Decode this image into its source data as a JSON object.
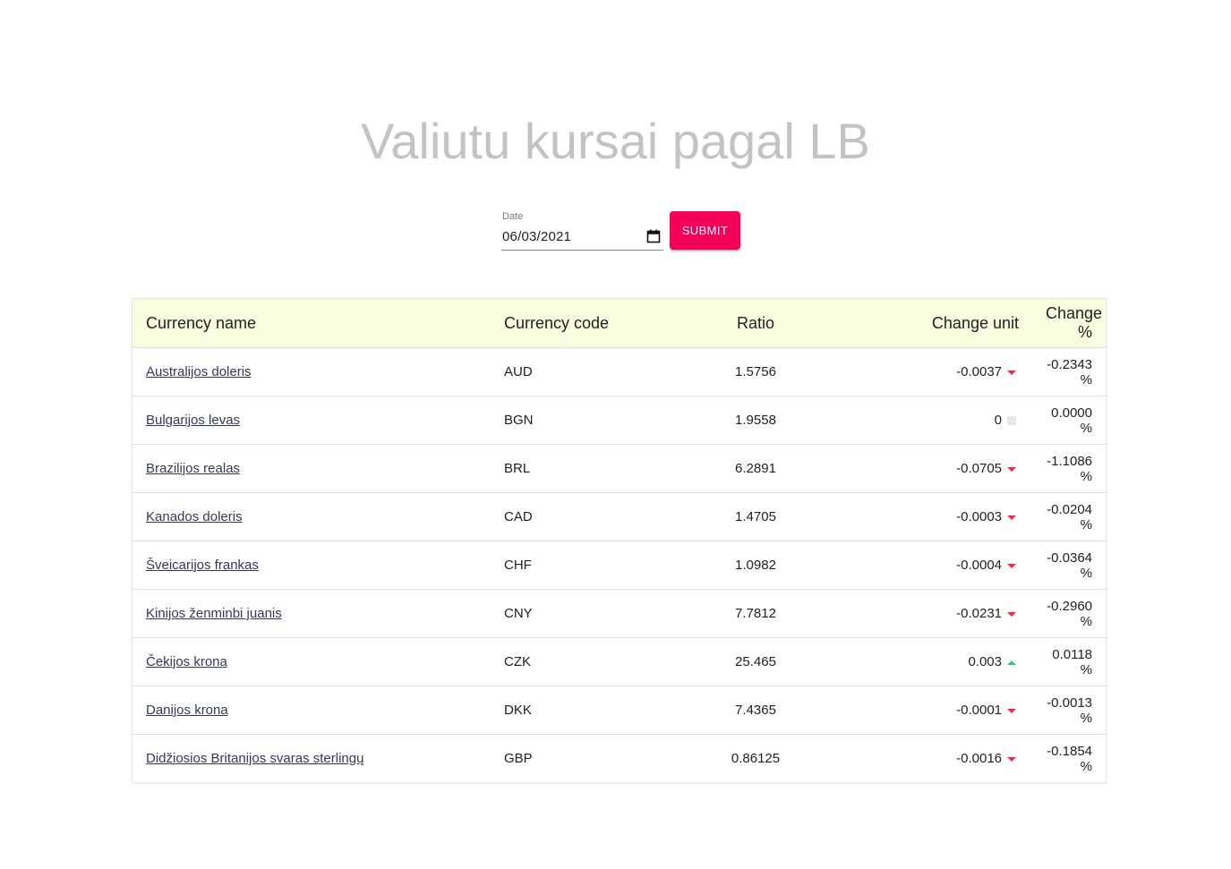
{
  "page": {
    "title": "Valiutu kursai pagal LB"
  },
  "form": {
    "date_label": "Date",
    "date_value": "06/03/2021",
    "submit_label": "SUBMIT",
    "calendar_icon": "calendar-icon",
    "submit_color": "#f50057"
  },
  "table": {
    "headers": {
      "name": "Currency name",
      "code": "Currency code",
      "ratio": "Ratio",
      "change_unit": "Change unit",
      "change_pct": "Change %"
    },
    "header_bg": "#f8fde0",
    "rows": [
      {
        "name": "Australijos doleris",
        "code": "AUD",
        "ratio": "1.5756",
        "change_unit": "-0.0037",
        "trend": "down",
        "change_pct": "-0.2343 %"
      },
      {
        "name": "Bulgarijos levas",
        "code": "BGN",
        "ratio": "1.9558",
        "change_unit": "0",
        "trend": "flat",
        "change_pct": "0.0000 %"
      },
      {
        "name": "Brazilijos realas",
        "code": "BRL",
        "ratio": "6.2891",
        "change_unit": "-0.0705",
        "trend": "down",
        "change_pct": "-1.1086 %"
      },
      {
        "name": "Kanados doleris",
        "code": "CAD",
        "ratio": "1.4705",
        "change_unit": "-0.0003",
        "trend": "down",
        "change_pct": "-0.0204 %"
      },
      {
        "name": "Šveicarijos frankas",
        "code": "CHF",
        "ratio": "1.0982",
        "change_unit": "-0.0004",
        "trend": "down",
        "change_pct": "-0.0364 %"
      },
      {
        "name": "Kinijos ženminbi juanis",
        "code": "CNY",
        "ratio": "7.7812",
        "change_unit": "-0.0231",
        "trend": "down",
        "change_pct": "-0.2960 %"
      },
      {
        "name": "Čekijos krona",
        "code": "CZK",
        "ratio": "25.465",
        "change_unit": "0.003",
        "trend": "up",
        "change_pct": "0.0118 %"
      },
      {
        "name": "Danijos krona",
        "code": "DKK",
        "ratio": "7.4365",
        "change_unit": "-0.0001",
        "trend": "down",
        "change_pct": "-0.0013 %"
      },
      {
        "name": "Didžiosios Britanijos svaras sterlingų",
        "code": "GBP",
        "ratio": "0.86125",
        "change_unit": "-0.0016",
        "trend": "down",
        "change_pct": "-0.1854 %"
      }
    ],
    "trend_colors": {
      "down": "#f0284a",
      "up": "#2ecc71",
      "flat": "#e8e8e8"
    }
  }
}
